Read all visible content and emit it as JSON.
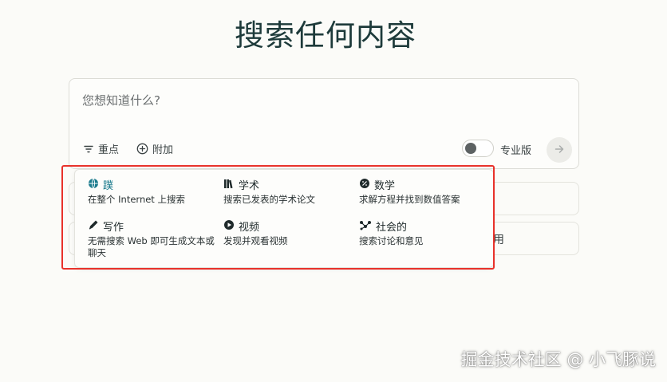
{
  "page": {
    "title": "搜索任何内容"
  },
  "search": {
    "placeholder": "您想知道什么?",
    "focus_label": "重点",
    "attach_label": "附加",
    "pro_label": "专业版",
    "pro_enabled": false
  },
  "focus_menu": {
    "options": [
      {
        "label": "蹼",
        "description": "在整个 Internet 上搜索",
        "icon": "globe-icon",
        "active": true
      },
      {
        "label": "学术",
        "description": "搜索已发表的学术论文",
        "icon": "books-icon",
        "active": false
      },
      {
        "label": "数学",
        "description": "求解方程并找到数值答案",
        "icon": "percent-icon",
        "active": false
      },
      {
        "label": "写作",
        "description": "无需搜索 Web 即可生成文本或聊天",
        "icon": "pencil-icon",
        "active": false
      },
      {
        "label": "视频",
        "description": "发现并观看视频",
        "icon": "play-icon",
        "active": false
      },
      {
        "label": "社会的",
        "description": "搜索讨论和意见",
        "icon": "network-icon",
        "active": false
      }
    ]
  },
  "behind": {
    "partial_text": "用"
  },
  "watermark": {
    "text": "掘金技术社区 @ 小飞豚说"
  },
  "colors": {
    "highlight": "#e8322b",
    "accent": "#1a7a8c",
    "title": "#1d3a3a"
  }
}
